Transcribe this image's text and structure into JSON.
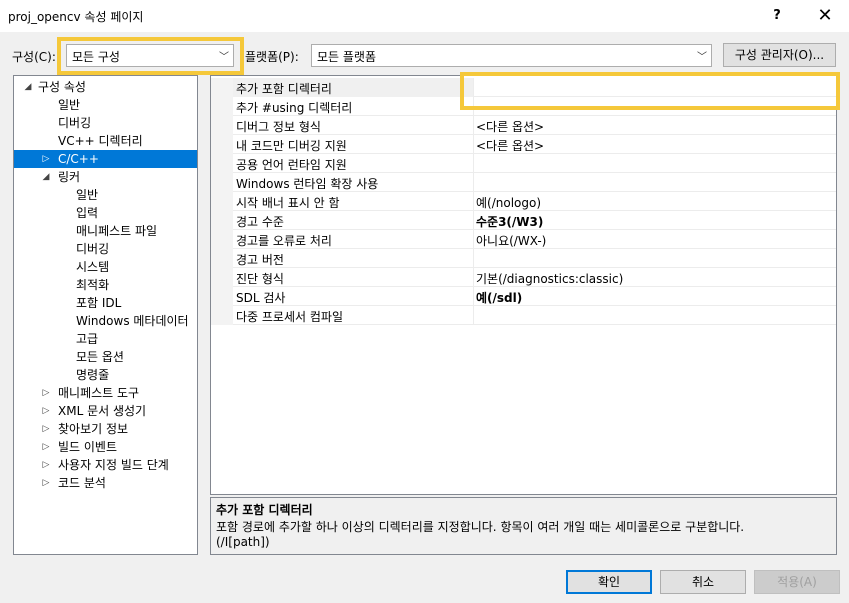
{
  "window": {
    "title": "proj_opencv 속성 페이지",
    "help_label": "?",
    "close_label": "✕"
  },
  "toolbar": {
    "config_label": "구성(C):",
    "config_value": "모든 구성",
    "platform_label": "플랫폼(P):",
    "platform_value": "모든 플랫폼",
    "config_manager_label": "구성 관리자(O)..."
  },
  "tree": {
    "items": [
      {
        "label": "구성 속성",
        "toggle": "◢"
      },
      {
        "label": "일반",
        "toggle": ""
      },
      {
        "label": "디버깅",
        "toggle": ""
      },
      {
        "label": "VC++ 디렉터리",
        "toggle": ""
      },
      {
        "label": "C/C++",
        "toggle": "▷"
      },
      {
        "label": "링커",
        "toggle": "◢"
      },
      {
        "label": "일반",
        "toggle": ""
      },
      {
        "label": "입력",
        "toggle": ""
      },
      {
        "label": "매니페스트 파일",
        "toggle": ""
      },
      {
        "label": "디버깅",
        "toggle": ""
      },
      {
        "label": "시스템",
        "toggle": ""
      },
      {
        "label": "최적화",
        "toggle": ""
      },
      {
        "label": "포함 IDL",
        "toggle": ""
      },
      {
        "label": "Windows 메타데이터",
        "toggle": ""
      },
      {
        "label": "고급",
        "toggle": ""
      },
      {
        "label": "모든 옵션",
        "toggle": ""
      },
      {
        "label": "명령줄",
        "toggle": ""
      },
      {
        "label": "매니페스트 도구",
        "toggle": "▷"
      },
      {
        "label": "XML 문서 생성기",
        "toggle": "▷"
      },
      {
        "label": "찾아보기 정보",
        "toggle": "▷"
      },
      {
        "label": "빌드 이벤트",
        "toggle": "▷"
      },
      {
        "label": "사용자 지정 빌드 단계",
        "toggle": "▷"
      },
      {
        "label": "코드 분석",
        "toggle": "▷"
      }
    ]
  },
  "grid": {
    "rows": [
      {
        "name": "추가 포함 디렉터리",
        "value": "",
        "bold": false
      },
      {
        "name": "추가 #using 디렉터리",
        "value": "",
        "bold": false
      },
      {
        "name": "디버그 정보 형식",
        "value": "<다른 옵션>",
        "bold": false
      },
      {
        "name": "내 코드만 디버깅 지원",
        "value": "<다른 옵션>",
        "bold": false
      },
      {
        "name": "공용 언어 런타임 지원",
        "value": "",
        "bold": false
      },
      {
        "name": "Windows 런타임 확장 사용",
        "value": "",
        "bold": false
      },
      {
        "name": "시작 배너 표시 안 함",
        "value": "예(/nologo)",
        "bold": false
      },
      {
        "name": "경고 수준",
        "value": "수준3(/W3)",
        "bold": true
      },
      {
        "name": "경고를 오류로 처리",
        "value": "아니요(/WX-)",
        "bold": false
      },
      {
        "name": "경고 버전",
        "value": "",
        "bold": false
      },
      {
        "name": "진단 형식",
        "value": "기본(/diagnostics:classic)",
        "bold": false
      },
      {
        "name": "SDL 검사",
        "value": "예(/sdl)",
        "bold": true
      },
      {
        "name": "다중 프로세서 컴파일",
        "value": "",
        "bold": false
      }
    ]
  },
  "description": {
    "title": "추가 포함 디렉터리",
    "text": "포함 경로에 추가할 하나 이상의 디렉터리를 지정합니다. 항목이 여러 개일 때는 세미콜론으로 구분합니다.",
    "switch": "(/I[path])"
  },
  "buttons": {
    "ok": "확인",
    "cancel": "취소",
    "apply": "적용(A)"
  },
  "colors": {
    "highlight": "#f5c83a",
    "selection": "#0078d7"
  }
}
